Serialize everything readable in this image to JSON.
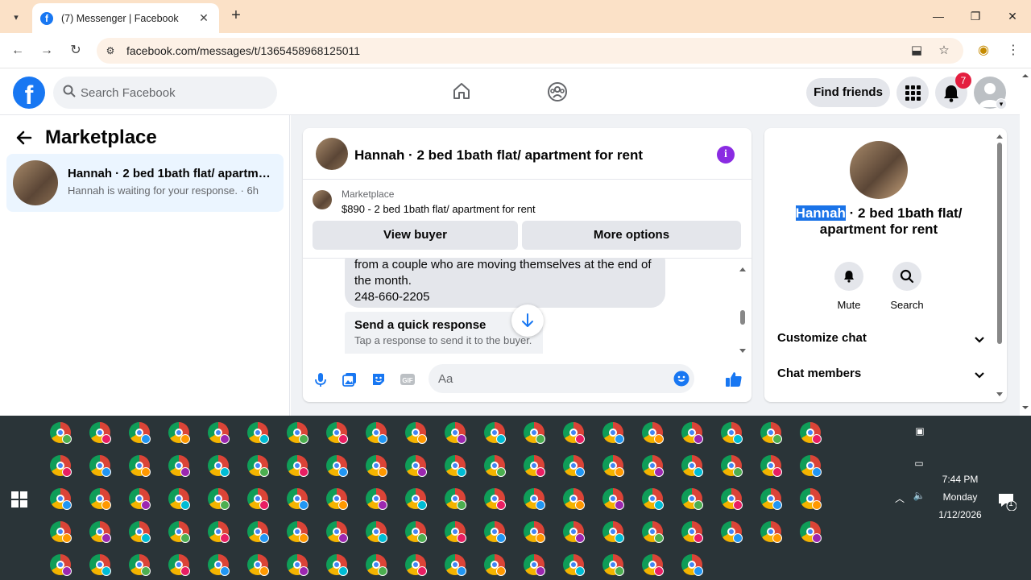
{
  "browser": {
    "tab_title": "(7) Messenger | Facebook",
    "url": "facebook.com/messages/t/1365458968125011"
  },
  "facebook": {
    "search_placeholder": "Search Facebook",
    "find_friends": "Find friends",
    "notification_count": "7"
  },
  "left_panel": {
    "title": "Marketplace",
    "conversation": {
      "name": "Hannah · 2 bed 1bath flat/ apartment for rent",
      "subtitle": "Hannah is waiting for your response. · 6h"
    }
  },
  "chat": {
    "title": "Hannah · 2 bed 1bath flat/ apartment for rent",
    "marketplace_label": "Marketplace",
    "listing": "$890 - 2 bed 1bath flat/ apartment for rent",
    "view_buyer": "View buyer",
    "more_options": "More options",
    "message_lines": [
      "from a couple who are moving themselves at the end of",
      "the month.",
      "248-660-2205"
    ],
    "quick_title": "Send a quick response",
    "quick_subtitle": "Tap a response to send it to the buyer.",
    "composer_placeholder": "Aa"
  },
  "right_panel": {
    "name_highlight": "Hannah",
    "name_rest_1": " · 2 bed 1bath flat/",
    "name_rest_2": "apartment for rent",
    "mute": "Mute",
    "search": "Search",
    "customize_chat": "Customize chat",
    "chat_members": "Chat members"
  },
  "taskbar": {
    "time": "7:44 PM",
    "day": "Monday",
    "date": "1/12/2026",
    "notification_count": "1"
  },
  "colors": {
    "facebook_blue": "#1877f2",
    "tabstrip": "#fbe1c7",
    "taskbar": "#2a3438",
    "selection": "#1a73e8"
  }
}
